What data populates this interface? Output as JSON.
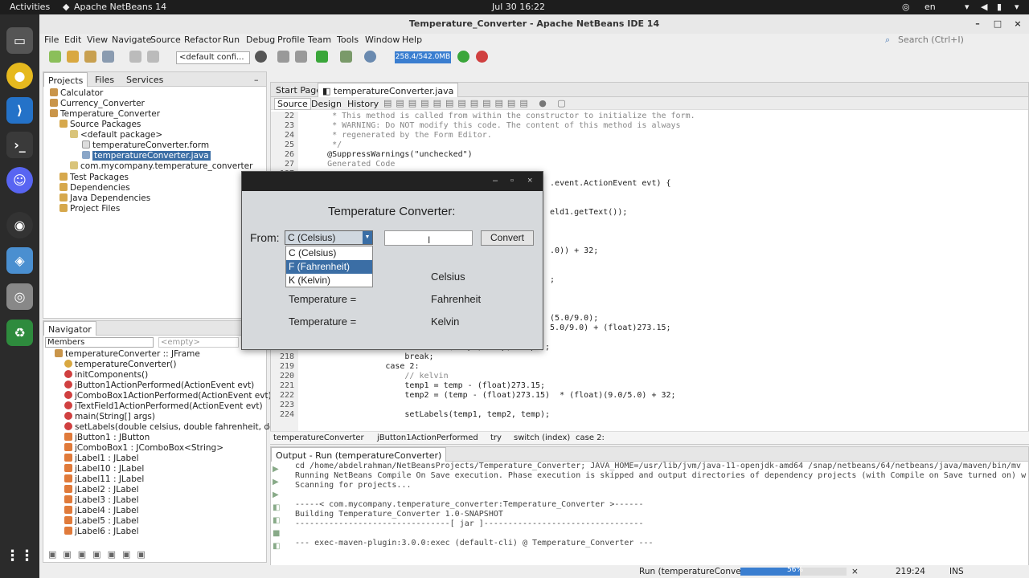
{
  "system": {
    "activities": "Activities",
    "app": "Apache NetBeans 14",
    "clock": "Jul 30  16:22",
    "lang": "en"
  },
  "window": {
    "title": "Temperature_Converter - Apache NetBeans IDE 14"
  },
  "menu": [
    "File",
    "Edit",
    "View",
    "Navigate",
    "Source",
    "Refactor",
    "Run",
    "Debug",
    "Profile",
    "Team",
    "Tools",
    "Window",
    "Help"
  ],
  "search_placeholder": "Search (Ctrl+I)",
  "toolbar": {
    "config": "<default confi...",
    "memory": "258.4/542.0MB"
  },
  "projects": {
    "tabs": [
      "Projects",
      "Files",
      "Services"
    ],
    "tree": [
      "Calculator",
      "Currency_Converter",
      "Temperature_Converter",
      "Source Packages",
      "<default package>",
      "temperatureConverter.form",
      "temperatureConverter.java",
      "com.mycompany.temperature_converter",
      "Test Packages",
      "Dependencies",
      "Java Dependencies",
      "Project Files"
    ]
  },
  "navigator": {
    "title": "Navigator",
    "filter": "Members",
    "empty": "<empty>",
    "items": [
      "temperatureConverter :: JFrame",
      "temperatureConverter()",
      "initComponents()",
      "jButton1ActionPerformed(ActionEvent evt)",
      "jComboBox1ActionPerformed(ActionEvent evt)",
      "jTextField1ActionPerformed(ActionEvent evt)",
      "main(String[] args)",
      "setLabels(double celsius, double fahrenheit, double ke",
      "jButton1 : JButton",
      "jComboBox1 : JComboBox<String>",
      "jLabel1 : JLabel",
      "jLabel10 : JLabel",
      "jLabel11 : JLabel",
      "jLabel2 : JLabel",
      "jLabel3 : JLabel",
      "jLabel4 : JLabel",
      "jLabel5 : JLabel",
      "jLabel6 : JLabel"
    ]
  },
  "editor": {
    "tabs": [
      "Start Page",
      "temperatureConverter.java"
    ],
    "subtabs": [
      "Source",
      "Design",
      "History"
    ],
    "lines": [
      {
        "n": "22",
        "t": "     * This method is called from within the constructor to initialize the form.",
        "c": "cm"
      },
      {
        "n": "23",
        "t": "     * WARNING: Do NOT modify this code. The content of this method is always",
        "c": "cm"
      },
      {
        "n": "24",
        "t": "     * regenerated by the Form Editor.",
        "c": "cm"
      },
      {
        "n": "25",
        "t": "     */",
        "c": "cm"
      },
      {
        "n": "26",
        "t": "    @SuppressWarnings(\"unchecked\")",
        "c": ""
      },
      {
        "n": "27",
        "t": "    Generated Code",
        "c": "cm"
      },
      {
        "n": "197",
        "t": "",
        "c": ""
      },
      {
        "n": "",
        "t": "                                                  .event.ActionEvent evt) {",
        "c": ""
      },
      {
        "n": "",
        "t": "",
        "c": ""
      },
      {
        "n": "",
        "t": "",
        "c": ""
      },
      {
        "n": "",
        "t": "                                                  eld1.getText());",
        "c": ""
      },
      {
        "n": "",
        "t": "",
        "c": ""
      },
      {
        "n": "",
        "t": "",
        "c": ""
      },
      {
        "n": "",
        "t": "",
        "c": ""
      },
      {
        "n": "",
        "t": "                                                  .0)) + 32;",
        "c": ""
      },
      {
        "n": "",
        "t": "",
        "c": ""
      },
      {
        "n": "",
        "t": "",
        "c": ""
      },
      {
        "n": "",
        "t": "                                                  ;",
        "c": ""
      },
      {
        "n": "",
        "t": "",
        "c": ""
      },
      {
        "n": "",
        "t": "",
        "c": ""
      },
      {
        "n": "",
        "t": "",
        "c": ""
      },
      {
        "n": "",
        "t": "                                                  (5.0/9.0);",
        "c": ""
      },
      {
        "n": "",
        "t": "                                                  5.0/9.0) + (float)273.15;",
        "c": ""
      },
      {
        "n": "",
        "t": "",
        "c": ""
      },
      {
        "n": "217",
        "t": "                    setLabels(temp1, temp, temp2);",
        "c": ""
      },
      {
        "n": "218",
        "t": "                    break;",
        "c": ""
      },
      {
        "n": "219",
        "t": "                case 2:",
        "c": ""
      },
      {
        "n": "220",
        "t": "                    // kelvin",
        "c": "cm"
      },
      {
        "n": "221",
        "t": "                    temp1 = temp - (float)273.15;",
        "c": ""
      },
      {
        "n": "222",
        "t": "                    temp2 = (temp - (float)273.15)  * (float)(9.0/5.0) + 32;",
        "c": ""
      },
      {
        "n": "223",
        "t": "",
        "c": ""
      },
      {
        "n": "224",
        "t": "                    setLabels(temp1, temp2, temp);",
        "c": ""
      }
    ],
    "breadcrumb": [
      "temperatureConverter",
      "jButton1ActionPerformed",
      "try",
      "switch (index)",
      "case 2:"
    ]
  },
  "output": {
    "title": "Output - Run (temperatureConverter)",
    "lines": [
      "cd /home/abdelrahman/NetBeansProjects/Temperature_Converter; JAVA_HOME=/usr/lib/jvm/java-11-openjdk-amd64 /snap/netbeans/64/netbeans/java/maven/bin/mv",
      "Running NetBeans Compile On Save execution. Phase execution is skipped and output directories of dependency projects (with Compile on Save turned on) w",
      "Scanning for projects...",
      "",
      "-----< com.mycompany.temperature_converter:Temperature_Converter >------",
      "Building Temperature_Converter 1.0-SNAPSHOT",
      "--------------------------------[ jar ]---------------------------------",
      "",
      "--- exec-maven-plugin:3.0.0:exec (default-cli) @ Temperature_Converter ---"
    ]
  },
  "status": {
    "task": "Run (temperatureConverter)",
    "progress_label": "56%",
    "progress": 0.56,
    "pos": "219:24",
    "mode": "INS"
  },
  "dialog": {
    "heading": "Temperature Converter:",
    "from": "From:",
    "selected": "C (Celsius)",
    "options": [
      "C (Celsius)",
      "F (Fahrenheit)",
      "K (Kelvin)"
    ],
    "highlighted": 1,
    "convert": "Convert",
    "temp_label": "Temperature =",
    "units": [
      "Celsius",
      "Fahrenheit",
      "Kelvin"
    ],
    "text_value": ""
  }
}
